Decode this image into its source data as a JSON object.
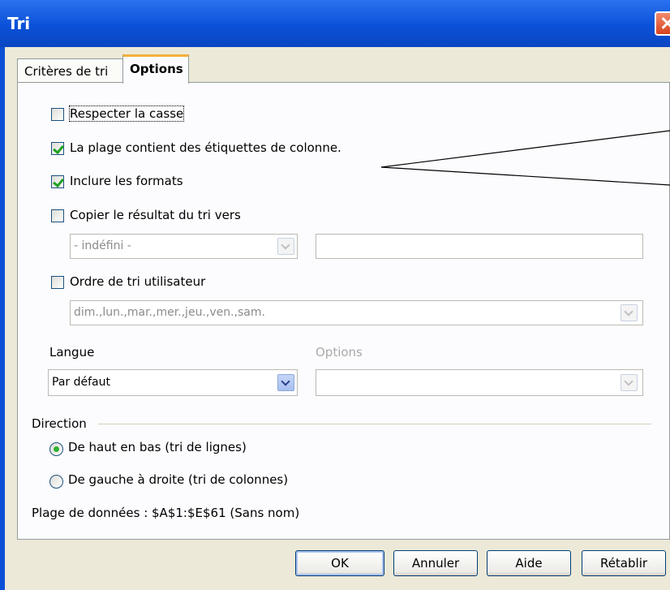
{
  "window": {
    "title": "Tri"
  },
  "tabs": [
    {
      "label": "Critères de tri",
      "active": false
    },
    {
      "label": "Options",
      "active": true
    }
  ],
  "options": {
    "case_sensitive": {
      "label": "Respecter la casse",
      "checked": false
    },
    "has_column_labels": {
      "label": "La plage contient des étiquettes de colonne.",
      "checked": true
    },
    "include_formats": {
      "label": "Inclure les formats",
      "checked": true
    },
    "copy_results": {
      "label": "Copier le résultat du tri vers",
      "checked": false,
      "target_value": "- indéfini -",
      "target_text": ""
    },
    "custom_order": {
      "label": "Ordre de tri utilisateur",
      "checked": false,
      "value": "dim.,lun.,mar.,mer.,jeu.,ven.,sam."
    },
    "language": {
      "label": "Langue",
      "value": "Par défaut"
    },
    "lang_options": {
      "label": "Options",
      "value": ""
    }
  },
  "direction": {
    "label": "Direction",
    "top_to_bottom": {
      "label": "De haut en bas (tri de lignes)",
      "selected": true
    },
    "left_to_right": {
      "label": "De gauche à droite (tri de colonnes)",
      "selected": false
    }
  },
  "data_range": "Plage de données : $A$1:$E$61 (Sans nom)",
  "buttons": {
    "ok": "OK",
    "cancel": "Annuler",
    "help": "Aide",
    "reset": "Rétablir"
  },
  "colors": {
    "titlebar": "#0b51d8",
    "dialog_bg": "#ece9d8",
    "panel_bg": "#fcfcfe",
    "accent_tab": "#f4b03d"
  }
}
